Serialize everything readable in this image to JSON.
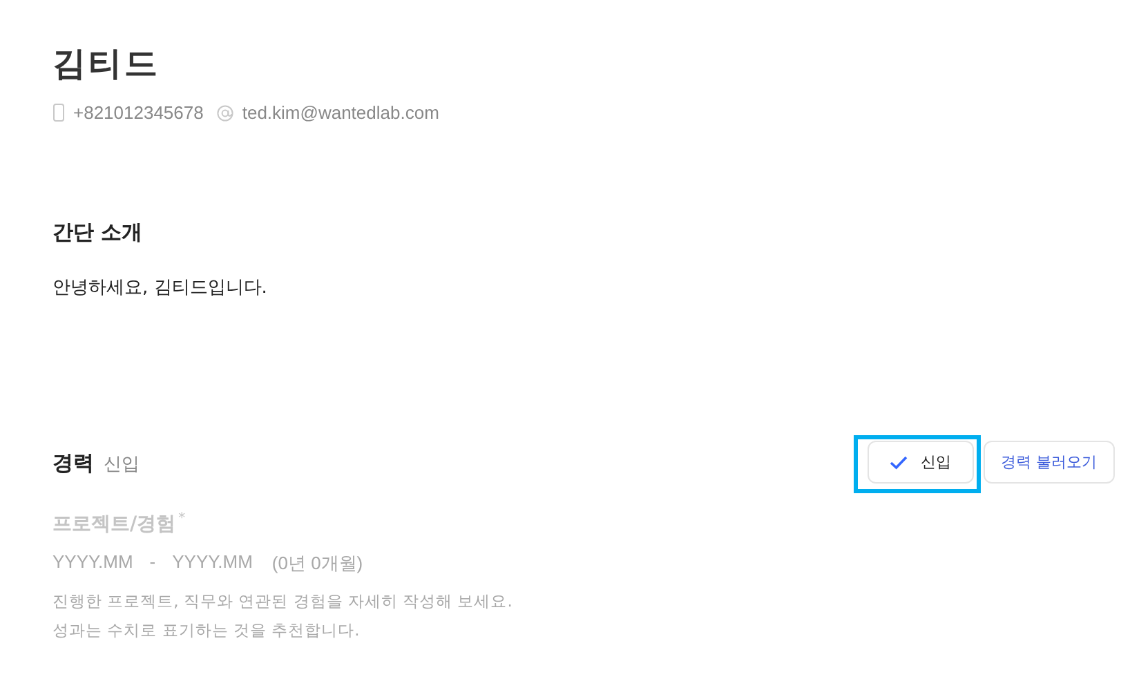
{
  "profile": {
    "name": "김티드",
    "phone": "+821012345678",
    "email": "ted.kim@wantedlab.com"
  },
  "intro": {
    "title": "간단 소개",
    "text": "안녕하세요, 김티드입니다."
  },
  "career": {
    "title": "경력",
    "status": "신입",
    "buttons": [
      {
        "kind": "toggle",
        "label": "신입",
        "checked": true,
        "highlighted": true
      },
      {
        "kind": "action",
        "label": "경력 불러오기",
        "highlighted": false
      }
    ],
    "entry": {
      "title_placeholder": "프로젝트/경험",
      "required_mark": "*",
      "start_placeholder": "YYYY.MM",
      "separator": "-",
      "end_placeholder": "YYYY.MM",
      "duration": "(0년 0개월)",
      "description_placeholder": "진행한 프로젝트, 직무와 연관된 경험을 자세히 작성해 보세요.\n성과는 수치로 표기하는 것을 추천합니다."
    }
  }
}
